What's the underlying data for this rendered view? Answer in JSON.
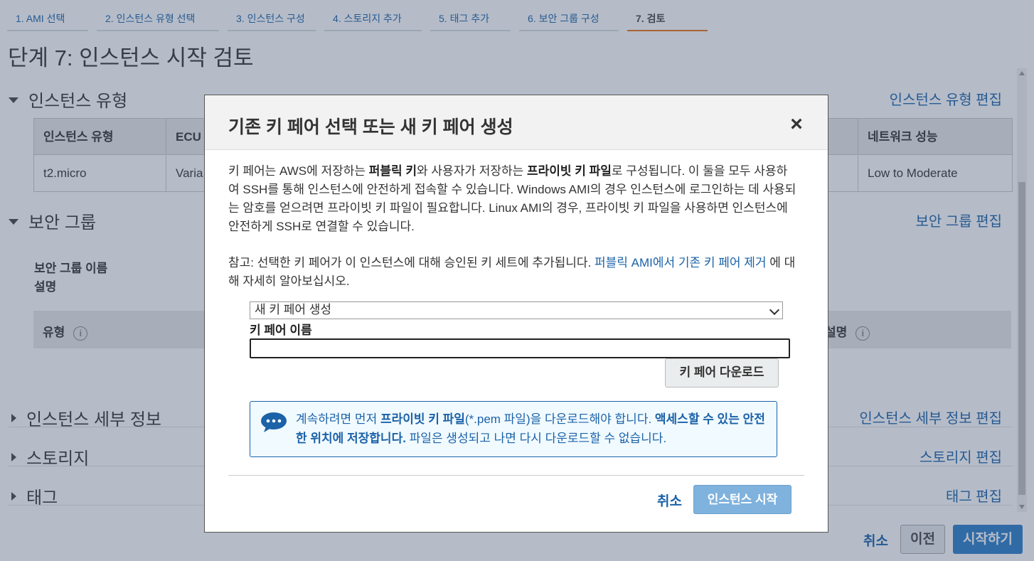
{
  "wizard": {
    "steps": [
      "1. AMI 선택",
      "2. 인스턴스 유형 선택",
      "3. 인스턴스 구성",
      "4. 스토리지 추가",
      "5. 태그 추가",
      "6. 보안 그룹 구성",
      "7. 검토"
    ],
    "active_step": "7. 검토"
  },
  "page": {
    "title": "단계 7: 인스턴스 시작 검토"
  },
  "sections": {
    "instance_type": {
      "title": "인스턴스 유형",
      "edit": "인스턴스 유형 편집",
      "columns": {
        "type": "인스턴스 유형",
        "ecu": "ECU",
        "network": "네트워크 성능"
      },
      "row": {
        "type": "t2.micro",
        "ecu": "Varia",
        "network": "Low to Moderate"
      }
    },
    "security_group": {
      "title": "보안 그룹",
      "edit": "보안 그룹 편집",
      "name_label": "보안 그룹 이름",
      "desc_label": "설명",
      "col_type": "유형",
      "col_desc": "설명"
    },
    "instance_details": {
      "title": "인스턴스 세부 정보",
      "edit": "인스턴스 세부 정보 편집"
    },
    "storage": {
      "title": "스토리지",
      "edit": "스토리지 편집"
    },
    "tags": {
      "title": "태그",
      "edit": "태그 편집"
    }
  },
  "footer": {
    "cancel": "취소",
    "previous": "이전",
    "launch": "시작하기"
  },
  "modal": {
    "title": "기존 키 페어 선택 또는 새 키 페어 생성",
    "close_icon": "close-icon",
    "para1": {
      "t1": "키 페어는 AWS에 저장하는 ",
      "b1": "퍼블릭 키",
      "t2": "와 사용자가 저장하는 ",
      "b2": "프라이빗 키 파일",
      "t3": "로 구성됩니다. 이 둘을 모두 사용하여 SSH를 통해 인스턴스에 안전하게 접속할 수 있습니다. Windows AMI의 경우 인스턴스에 로그인하는 데 사용되는 암호를 얻으려면 프라이빗 키 파일이 필요합니다. Linux AMI의 경우, 프라이빗 키 파일을 사용하면 인스턴스에 안전하게 SSH로 연결할 수 있습니다."
    },
    "note": {
      "text": "참고: 선택한 키 페어가 이 인스턴스에 대해 승인된 키 세트에 추가됩니다. ",
      "link": "퍼블릭 AMI에서 기존 키 페어 제거",
      "suffix": " 에 대해 자세히 알아보십시오."
    },
    "select_value": "새 키 페어 생성",
    "keypair_label": "키 페어 이름",
    "keypair_value": "",
    "download_button": "키 페어 다운로드",
    "info": {
      "icon": "chat-bubble-icon",
      "t1": "계속하려면 먼저 ",
      "b1": "프라이빗 키 파일",
      "t2": "(*.pem 파일)을 다운로드해야 합니다. ",
      "b2": "액세스할 수 있는 안전한 위치에 저장합니다.",
      "t3": " 파일은 생성되고 나면 다시 다운로드할 수 없습니다."
    },
    "cancel": "취소",
    "launch": "인스턴스 시작"
  }
}
